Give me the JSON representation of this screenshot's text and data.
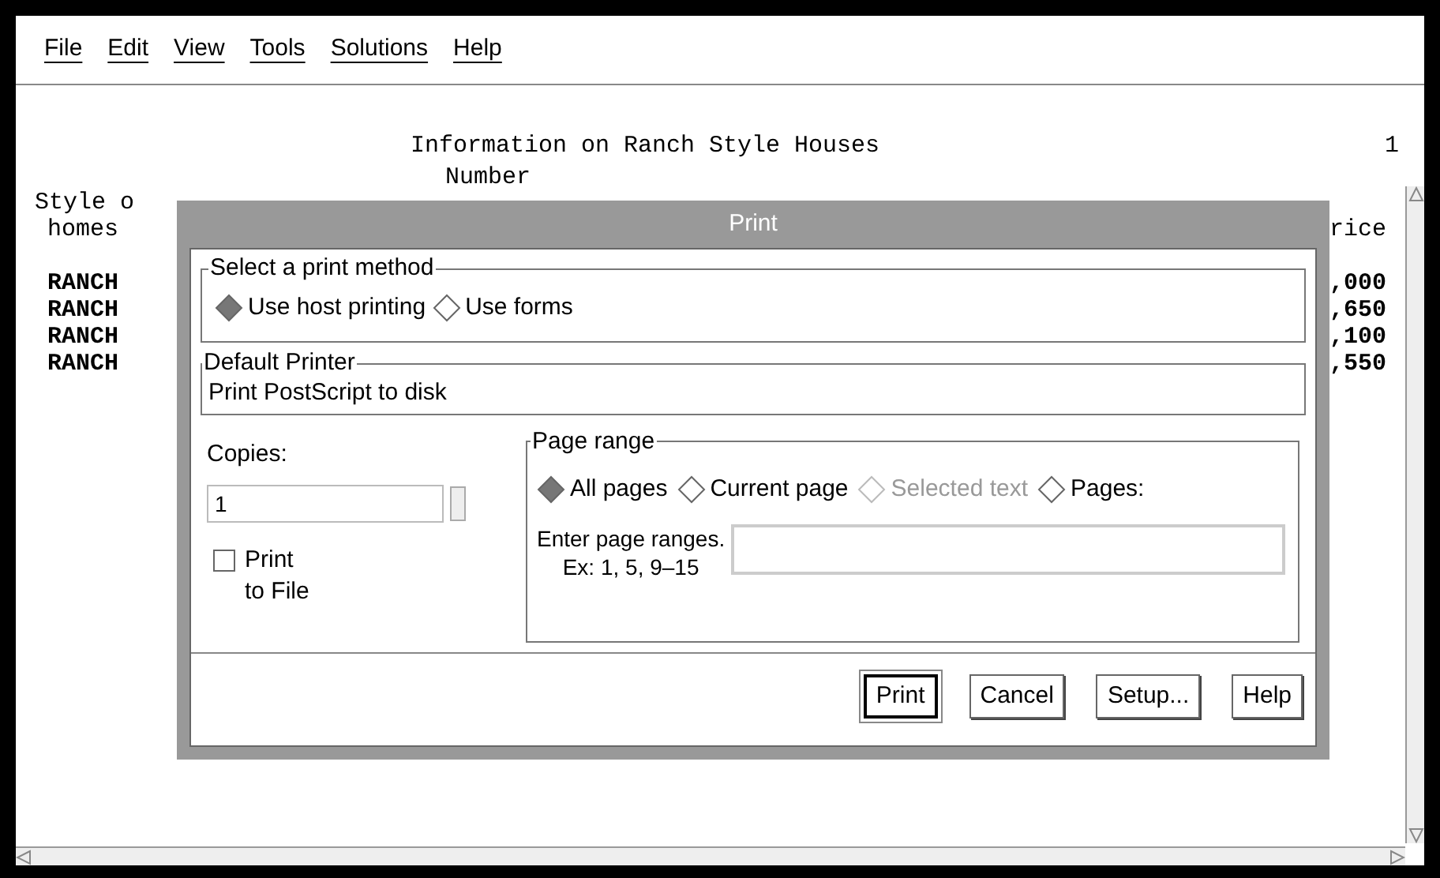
{
  "menu": [
    {
      "label": "File"
    },
    {
      "label": "Edit"
    },
    {
      "label": "View"
    },
    {
      "label": "Tools"
    },
    {
      "label": "Solutions"
    },
    {
      "label": "Help"
    }
  ],
  "report": {
    "title": "Information on Ranch Style Houses",
    "page": "1",
    "column_header": "Number",
    "rows": [
      {
        "kind": "header",
        "left": "Style o"
      },
      {
        "kind": "header",
        "left": "homes",
        "right": "rice"
      },
      {
        "kind": "data",
        "left": "RANCH",
        "right": ",000"
      },
      {
        "kind": "data",
        "left": "RANCH",
        "right": ",650"
      },
      {
        "kind": "data",
        "left": "RANCH",
        "right": ",100"
      },
      {
        "kind": "data",
        "left": "RANCH",
        "right": ",550"
      }
    ]
  },
  "dialog": {
    "title": "Print",
    "method": {
      "legend": "Select a print method",
      "options": [
        {
          "label": "Use host printing",
          "selected": true,
          "disabled": false
        },
        {
          "label": "Use forms",
          "selected": false,
          "disabled": false
        }
      ]
    },
    "printer": {
      "legend": "Default Printer",
      "value": "Print PostScript to disk"
    },
    "copies": {
      "label": "Copies:",
      "value": "1"
    },
    "print_to_file": {
      "label_lines": [
        "Print",
        "to File"
      ],
      "checked": false
    },
    "page_range": {
      "legend": "Page range",
      "options": [
        {
          "label": "All pages",
          "selected": true,
          "disabled": false
        },
        {
          "label": "Current page",
          "selected": false,
          "disabled": false
        },
        {
          "label": "Selected text",
          "selected": false,
          "disabled": true
        },
        {
          "label": "Pages:",
          "selected": false,
          "disabled": false
        }
      ],
      "hint_lines": [
        "Enter page ranges.",
        "Ex: 1, 5, 9–15"
      ]
    },
    "buttons": [
      {
        "label": "Print",
        "default": true
      },
      {
        "label": "Cancel",
        "default": false
      },
      {
        "label": "Setup...",
        "default": false
      },
      {
        "label": "Help",
        "default": false
      }
    ]
  }
}
